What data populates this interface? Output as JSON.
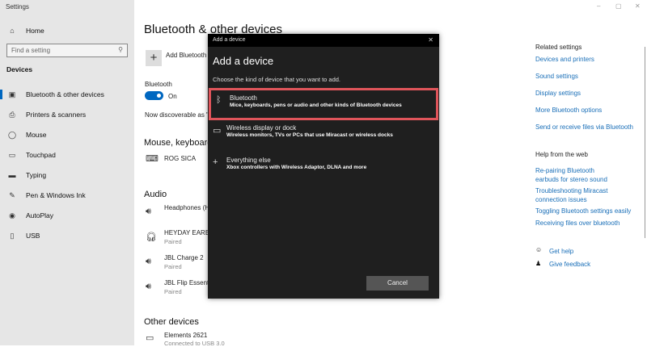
{
  "window": {
    "title": "Settings",
    "controls": [
      "–",
      "▢",
      "✕"
    ]
  },
  "sidebar": {
    "home": "Home",
    "search_placeholder": "Find a setting",
    "section": "Devices",
    "items": [
      {
        "label": "Bluetooth & other devices",
        "icon": "bluetooth-devices-icon",
        "glyph": "▣"
      },
      {
        "label": "Printers & scanners",
        "icon": "printer-icon",
        "glyph": "⎙"
      },
      {
        "label": "Mouse",
        "icon": "mouse-icon",
        "glyph": "◯"
      },
      {
        "label": "Touchpad",
        "icon": "touchpad-icon",
        "glyph": "▭"
      },
      {
        "label": "Typing",
        "icon": "keyboard-icon",
        "glyph": "▬"
      },
      {
        "label": "Pen & Windows Ink",
        "icon": "pen-icon",
        "glyph": "✎"
      },
      {
        "label": "AutoPlay",
        "icon": "autoplay-icon",
        "glyph": "◉"
      },
      {
        "label": "USB",
        "icon": "usb-icon",
        "glyph": "▯"
      }
    ]
  },
  "main": {
    "title": "Bluetooth & other devices",
    "add_label": "Add Bluetooth",
    "bt_label": "Bluetooth",
    "bt_state": "On",
    "bt_on": true,
    "discoverable": "Now discoverable as \"",
    "mouse_header": "Mouse, keyboard",
    "mouse_device": "ROG SICA",
    "audio_header": "Audio",
    "audio": [
      {
        "name": "Headphones (H",
        "status": ""
      },
      {
        "name": "HEYDAY EARBU",
        "status": "Paired"
      },
      {
        "name": "JBL Charge 2",
        "status": "Paired"
      },
      {
        "name": "JBL Flip Essenti",
        "status": "Paired"
      }
    ],
    "other_header": "Other devices",
    "other_device": "Elements 2621",
    "other_status": "Connected to USB 3.0"
  },
  "right": {
    "related_header": "Related settings",
    "related": [
      "Devices and printers",
      "Sound settings",
      "Display settings",
      "More Bluetooth options",
      "Send or receive files via Bluetooth"
    ],
    "help_header": "Help from the web",
    "help": [
      "Re-pairing Bluetooth earbuds for stereo sound",
      "Troubleshooting Miracast connection issues",
      "Toggling Bluetooth settings easily",
      "Receiving files over bluetooth"
    ],
    "get_help": "Get help",
    "feedback": "Give feedback"
  },
  "dialog": {
    "titlebar": "Add a device",
    "heading": "Add a device",
    "prompt": "Choose the kind of device that you want to add.",
    "options": [
      {
        "name": "Bluetooth",
        "desc": "Mice, keyboards, pens or audio and other kinds of Bluetooth devices",
        "glyph": "ᛒ"
      },
      {
        "name": "Wireless display or dock",
        "desc": "Wireless monitors, TVs or PCs that use Miracast or wireless docks",
        "glyph": "▭"
      },
      {
        "name": "Everything else",
        "desc": "Xbox controllers with Wireless Adaptor, DLNA and more",
        "glyph": "+"
      }
    ],
    "cancel": "Cancel",
    "highlight_color": "#e0555b"
  }
}
